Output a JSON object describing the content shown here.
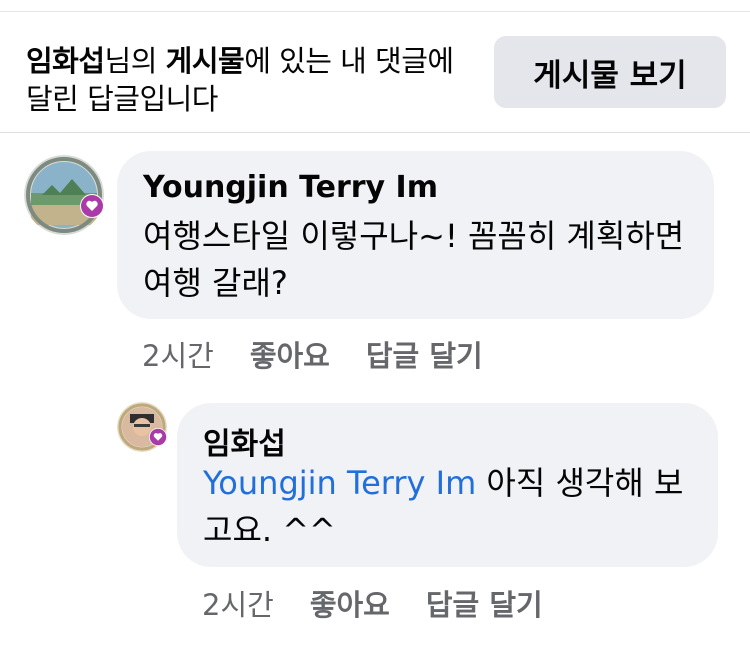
{
  "header": {
    "author": "임화섭",
    "text_after_author": "님의 ",
    "post_word": "게시물",
    "text_rest": "에 있는 내 댓글에 달린 답글입니다",
    "view_post_button": "게시물 보기"
  },
  "comment": {
    "author": "Youngjin Terry Im",
    "text": "여행스타일 이렇구나~! 꼼꼼히 계획하면 여행 갈래?",
    "time": "2시간",
    "like": "좋아요",
    "reply": "답글 달기",
    "avatar_icon": "profile-photo-frame-icon",
    "badge_icon": "heart-badge-icon"
  },
  "reply": {
    "author": "임화섭",
    "mention": "Youngjin Terry Im",
    "text": " 아직 생각해 보고요. ^^",
    "time": "2시간",
    "like": "좋아요",
    "reply": "답글 달기",
    "avatar_icon": "profile-photo-frame-icon",
    "badge_icon": "heart-badge-icon"
  },
  "colors": {
    "bubble": "#f0f2f5",
    "button": "#e4e6eb",
    "mention": "#216fdb",
    "meta": "#65676b",
    "badge": "#a93aa7"
  }
}
